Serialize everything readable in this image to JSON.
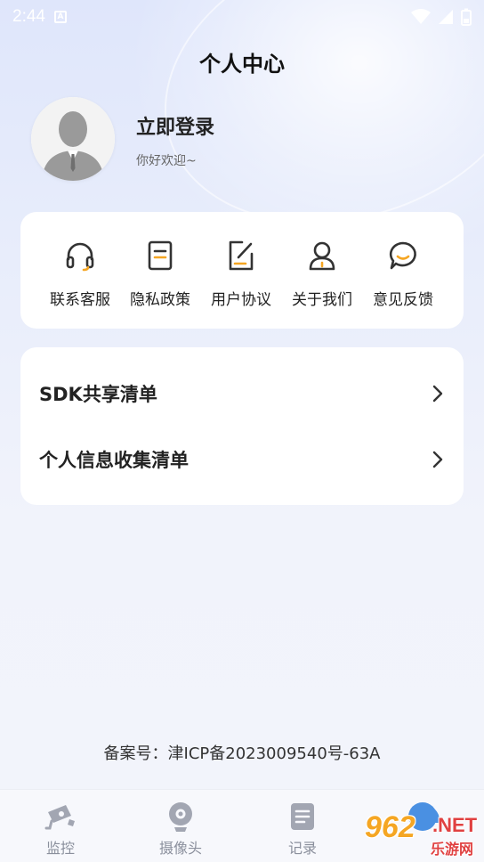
{
  "status_bar": {
    "time": "2:44",
    "notification_badge": "A"
  },
  "header": {
    "title": "个人中心"
  },
  "profile": {
    "login_label": "立即登录",
    "welcome": "你好欢迎~"
  },
  "quick_links": [
    {
      "label": "联系客服",
      "icon": "headset-icon"
    },
    {
      "label": "隐私政策",
      "icon": "document-icon"
    },
    {
      "label": "用户协议",
      "icon": "edit-document-icon"
    },
    {
      "label": "关于我们",
      "icon": "user-icon"
    },
    {
      "label": "意见反馈",
      "icon": "chat-bubble-icon"
    }
  ],
  "list_items": [
    {
      "label": "SDK共享清单"
    },
    {
      "label": "个人信息收集清单"
    }
  ],
  "footer": {
    "icp": "备案号：津ICP备2023009540号-63A"
  },
  "bottom_nav": [
    {
      "label": "监控",
      "icon": "camera-surveillance-icon"
    },
    {
      "label": "摄像头",
      "icon": "webcam-icon"
    },
    {
      "label": "记录",
      "icon": "record-list-icon"
    },
    {
      "label": "",
      "icon": "profile-icon"
    }
  ],
  "watermark": {
    "number": "962",
    "suffix": ".NET",
    "site_name": "乐游网"
  },
  "colors": {
    "accent_orange": "#f5a623",
    "icon_dark": "#333333",
    "nav_inactive": "#8a8f9c",
    "nav_active": "#4a90e2"
  }
}
